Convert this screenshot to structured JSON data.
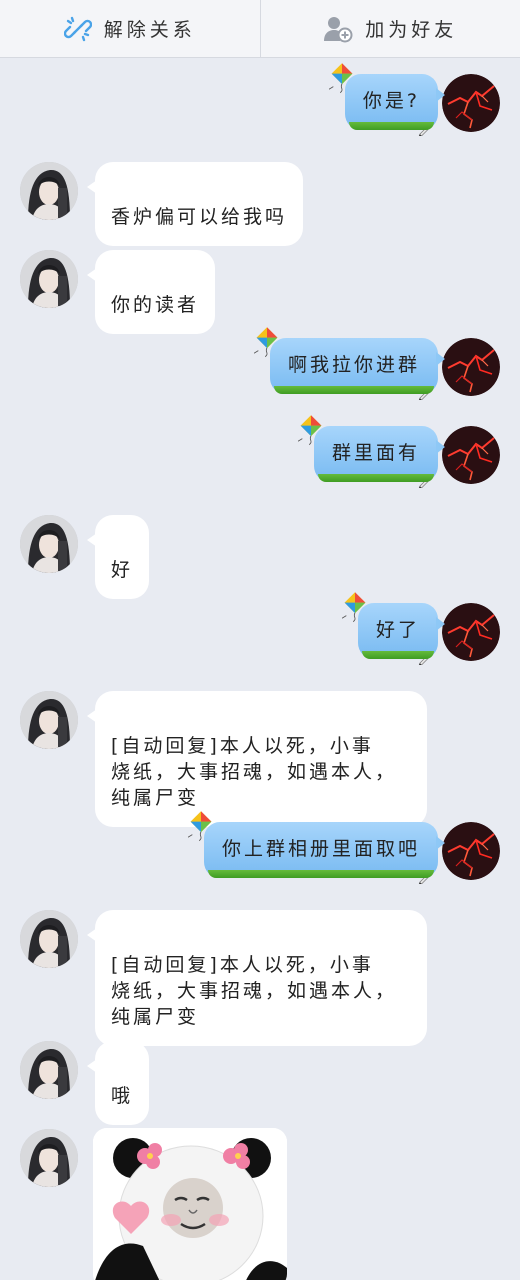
{
  "topbar": {
    "unbind_label": "解除关系",
    "add_friend_label": "加为好友"
  },
  "messages": [
    {
      "side": "out",
      "text": "你是?"
    },
    {
      "side": "in",
      "text": "香炉偏可以给我吗"
    },
    {
      "side": "in",
      "text": "你的读者"
    },
    {
      "side": "out",
      "text": "啊我拉你进群"
    },
    {
      "side": "out",
      "text": "群里面有"
    },
    {
      "side": "in",
      "text": "好"
    },
    {
      "side": "out",
      "text": "好了"
    },
    {
      "side": "in",
      "text": "[自动回复]本人以死，小事\n烧纸，大事招魂，如遇本人，\n纯属尸变"
    },
    {
      "side": "out",
      "text": "你上群相册里面取吧"
    },
    {
      "side": "in",
      "text": "[自动回复]本人以死，小事\n烧纸，大事招魂，如遇本人，\n纯属尸变"
    },
    {
      "side": "in",
      "text": "哦"
    },
    {
      "side": "in",
      "type": "sticker",
      "icon": "panda-heart-sticker"
    }
  ],
  "colors": {
    "background": "#e8ebf2",
    "bubble_out": "#8ec8f6",
    "bubble_in": "#ffffff",
    "grass": "#4caf2f"
  }
}
